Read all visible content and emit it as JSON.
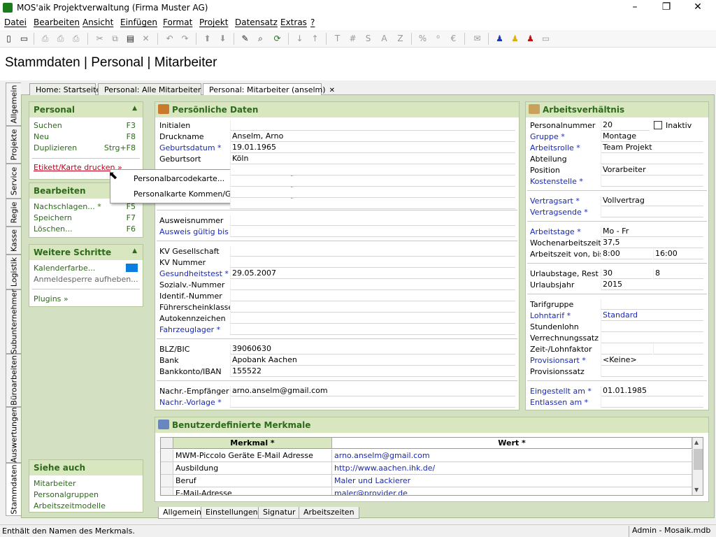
{
  "window": {
    "title": "MOS'aik Projektverwaltung (Firma Muster AG)",
    "minimize": "–",
    "maximize": "❐",
    "close": "✕"
  },
  "menu": [
    "Datei",
    "Bearbeiten",
    "Ansicht",
    "Einfügen",
    "Format",
    "Projekt",
    "Datensatz",
    "Extras",
    "?"
  ],
  "header": {
    "title": "Stammdaten | Personal | Mitarbeiter"
  },
  "vtabs": [
    "Allgemein",
    "Projekte",
    "Service",
    "Regie",
    "Kasse",
    "Logistik",
    "Subunternehmer",
    "Büroarbeiten",
    "Auswertungen",
    "Stammdaten"
  ],
  "doc_tabs": [
    {
      "label": "Home: Startseite"
    },
    {
      "label": "Personal: Alle Mitarbeiter",
      "close": "✕"
    },
    {
      "label": "Personal: Mitarbeiter (anselm)",
      "close": "✕"
    }
  ],
  "sidebar": {
    "personal": {
      "title": "Personal",
      "items": [
        {
          "label": "Suchen",
          "key": "F3"
        },
        {
          "label": "Neu",
          "key": "F8"
        },
        {
          "label": "Duplizieren",
          "key": "Strg+F8"
        }
      ],
      "print": "Etikett/Karte drucken »"
    },
    "bearbeiten": {
      "title": "Bearbeiten",
      "items": [
        {
          "label": "Nachschlagen... *",
          "key": "F5"
        },
        {
          "label": "Speichern",
          "key": "F7"
        },
        {
          "label": "Löschen...",
          "key": "F6"
        }
      ]
    },
    "weitere": {
      "title": "Weitere Schritte",
      "kalender": "Kalenderfarbe...",
      "anmelde": "Anmeldesperre aufheben...",
      "plugins": "Plugins »",
      "kalender_color": "#0a7de0"
    },
    "siehe": {
      "title": "Siehe auch",
      "items": [
        "Mitarbeiter",
        "Personalgruppen",
        "Arbeitszeitmodelle"
      ]
    }
  },
  "popup": [
    "Personalbarcodekarte...",
    "Personalkarte Kommen/Gehen..."
  ],
  "persoenlich": {
    "title": "Persönliche Daten",
    "fields": {
      "initialen": {
        "label": "Initialen",
        "value": ""
      },
      "druckname": {
        "label": "Druckname",
        "value": "Anselm, Arno"
      },
      "geburtsdatum": {
        "label": "Geburtsdatum *",
        "value": "19.01.1965"
      },
      "geburtsort": {
        "label": "Geburtsort",
        "value": "Köln"
      },
      "ausweisnummer": {
        "label": "Ausweisnummer",
        "value": ""
      },
      "ausweis_gueltig": {
        "label": "Ausweis gültig bis *",
        "value": ""
      },
      "kv_gesellschaft": {
        "label": "KV Gesellschaft",
        "value": ""
      },
      "kv_nummer": {
        "label": "KV Nummer",
        "value": ""
      },
      "gesundheitstest": {
        "label": "Gesundheitstest *",
        "value": "29.05.2007"
      },
      "sozialv": {
        "label": "Sozialv.-Nummer",
        "value": ""
      },
      "identif": {
        "label": "Identif.-Nummer",
        "value": ""
      },
      "fuehrerschein": {
        "label": "Führerscheinklasse",
        "value": ""
      },
      "autokennzeichen": {
        "label": "Autokennzeichen",
        "value": ""
      },
      "fahrzeuglager": {
        "label": "Fahrzeuglager *",
        "value": ""
      },
      "blz": {
        "label": "BLZ/BIC",
        "value": "39060630"
      },
      "bank": {
        "label": "Bank",
        "value": "Apobank Aachen"
      },
      "bankkonto": {
        "label": "Bankkonto/IBAN",
        "value": "155522"
      },
      "nachr_empfaenger": {
        "label": "Nachr.-Empfänger",
        "value": "arno.anselm@gmail.com"
      },
      "nachr_vorlage": {
        "label": "Nachr.-Vorlage *",
        "value": ""
      }
    }
  },
  "arbeit": {
    "title": "Arbeitsverhältnis",
    "inaktiv": "Inaktiv",
    "fields": {
      "personalnummer": {
        "label": "Personalnummer",
        "value": "20"
      },
      "gruppe": {
        "label": "Gruppe *",
        "value": "Montage"
      },
      "arbeitsrolle": {
        "label": "Arbeitsrolle *",
        "value": "Team Projekt"
      },
      "abteilung": {
        "label": "Abteilung",
        "value": ""
      },
      "position": {
        "label": "Position",
        "value": "Vorarbeiter"
      },
      "kostenstelle": {
        "label": "Kostenstelle *",
        "value": ""
      },
      "vertragsart": {
        "label": "Vertragsart *",
        "value": "Vollvertrag"
      },
      "vertragsende": {
        "label": "Vertragsende *",
        "value": ""
      },
      "arbeitstage": {
        "label": "Arbeitstage *",
        "value": "Mo - Fr"
      },
      "wochenarbeitszeit": {
        "label": "Wochenarbeitszeit",
        "value": "37,5"
      },
      "arbeitszeit": {
        "label": "Arbeitszeit von, bis",
        "from": "8:00",
        "to": "16:00"
      },
      "urlaubstage": {
        "label": "Urlaubstage, Rest",
        "value": "30",
        "rest": "8"
      },
      "urlaubsjahr": {
        "label": "Urlaubsjahr",
        "value": "2015"
      },
      "tarifgruppe": {
        "label": "Tarifgruppe",
        "value": ""
      },
      "lohntarif": {
        "label": "Lohntarif *",
        "value": "Standard"
      },
      "stundenlohn": {
        "label": "Stundenlohn",
        "value": ""
      },
      "verrechnungssatz": {
        "label": "Verrechnungssatz",
        "value": ""
      },
      "zeitlohnfaktor": {
        "label": "Zeit-/Lohnfaktor",
        "value": ""
      },
      "provisionsart": {
        "label": "Provisionsart *",
        "value": "<Keine>"
      },
      "provisionssatz": {
        "label": "Provisionssatz",
        "value": ""
      },
      "eingestellt": {
        "label": "Eingestellt am *",
        "value": "01.01.1985"
      },
      "entlassen": {
        "label": "Entlassen am *",
        "value": ""
      }
    }
  },
  "merkmale": {
    "title": "Benutzerdefinierte Merkmale",
    "columns": [
      "Merkmal *",
      "Wert *"
    ],
    "rows": [
      {
        "merkmal": "MWM-Piccolo Geräte E-Mail Adresse",
        "wert": "arno.anselm@gmail.com"
      },
      {
        "merkmal": "Ausbildung",
        "wert": "http://www.aachen.ihk.de/"
      },
      {
        "merkmal": "Beruf",
        "wert": "Maler und Lackierer"
      },
      {
        "merkmal": "E-Mail-Adresse",
        "wert": "maler@provider.de"
      }
    ],
    "scroll_up": "▲",
    "scroll_down": "▼"
  },
  "bottom_tabs": [
    "Allgemein",
    "Einstellungen",
    "Signatur",
    "Arbeitszeiten"
  ],
  "status": {
    "text": "Enthält den Namen des Merkmals.",
    "db": "Admin - Mosaik.mdb"
  }
}
